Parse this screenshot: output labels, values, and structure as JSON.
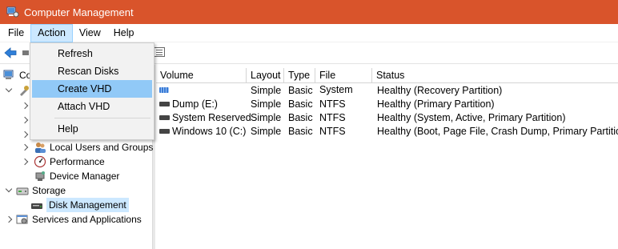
{
  "window": {
    "title": "Computer Management",
    "icon": "computer-management-icon"
  },
  "menubar": {
    "items": [
      "File",
      "Action",
      "View",
      "Help"
    ],
    "active": "Action"
  },
  "action_menu": {
    "items": [
      "Refresh",
      "Rescan Disks",
      "Create VHD",
      "Attach VHD",
      "Help"
    ],
    "highlighted": "Create VHD"
  },
  "tree": {
    "root_label_partial": "Co",
    "items": [
      {
        "label": "Local Users and Groups",
        "icon": "users-icon"
      },
      {
        "label": "Performance",
        "icon": "performance-icon"
      },
      {
        "label": "Device Manager",
        "icon": "device-manager-icon"
      },
      {
        "label": "Storage",
        "icon": "storage-icon"
      },
      {
        "label": "Disk Management",
        "icon": "disk-management-icon"
      },
      {
        "label": "Services and Applications",
        "icon": "services-icon"
      }
    ],
    "selected": "Disk Management"
  },
  "volumes": {
    "columns": [
      "Volume",
      "Layout",
      "Type",
      "File System",
      "Status"
    ],
    "rows": [
      {
        "volume": "",
        "layout": "Simple",
        "type": "Basic",
        "fs": "",
        "status": "Healthy (Recovery Partition)"
      },
      {
        "volume": "Dump (E:)",
        "layout": "Simple",
        "type": "Basic",
        "fs": "NTFS",
        "status": "Healthy (Primary Partition)"
      },
      {
        "volume": "System Reserved",
        "layout": "Simple",
        "type": "Basic",
        "fs": "NTFS",
        "status": "Healthy (System, Active, Primary Partition)"
      },
      {
        "volume": "Windows 10 (C:)",
        "layout": "Simple",
        "type": "Basic",
        "fs": "NTFS",
        "status": "Healthy (Boot, Page File, Crash Dump, Primary Partition)"
      }
    ]
  },
  "colors": {
    "titlebar": "#d9542b",
    "highlight": "#91c9f7",
    "selection": "#cce8ff"
  }
}
